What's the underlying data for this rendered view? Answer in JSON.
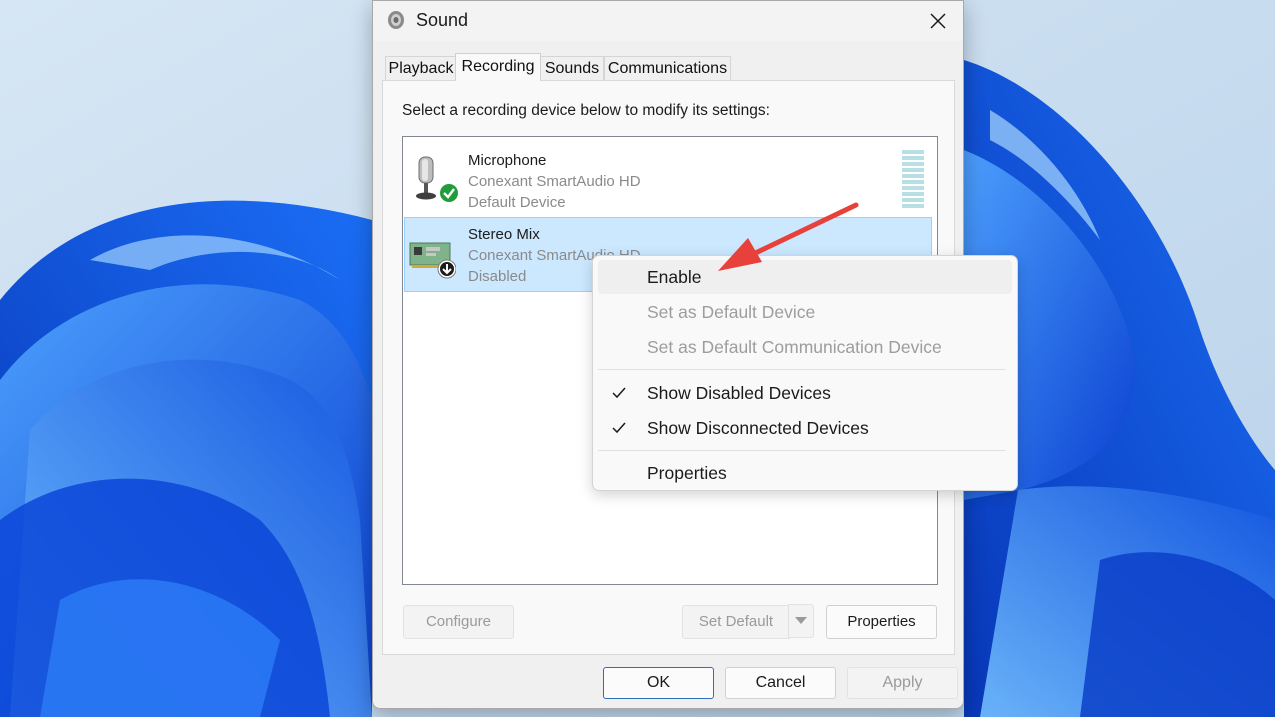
{
  "window": {
    "title": "Sound"
  },
  "tabs": [
    {
      "label": "Playback"
    },
    {
      "label": "Recording"
    },
    {
      "label": "Sounds"
    },
    {
      "label": "Communications"
    }
  ],
  "active_tab": "Recording",
  "instruction": "Select a recording device below to modify its settings:",
  "devices": [
    {
      "name": "Microphone",
      "driver": "Conexant SmartAudio HD",
      "status": "Default Device",
      "icon": "microphone-icon",
      "badge": "default-check-icon"
    },
    {
      "name": "Stereo Mix",
      "driver": "Conexant SmartAudio HD",
      "status": "Disabled",
      "icon": "sound-card-icon",
      "badge": "disabled-arrow-icon"
    }
  ],
  "panel_buttons": {
    "configure": "Configure",
    "set_default": "Set Default",
    "properties": "Properties"
  },
  "dialog_buttons": {
    "ok": "OK",
    "cancel": "Cancel",
    "apply": "Apply"
  },
  "context_menu": {
    "items": [
      {
        "label": "Enable",
        "enabled": true,
        "checked": false,
        "highlighted": true
      },
      {
        "label": "Set as Default Device",
        "enabled": false,
        "checked": false
      },
      {
        "label": "Set as Default Communication Device",
        "enabled": false,
        "checked": false
      },
      {
        "label": "Show Disabled Devices",
        "enabled": true,
        "checked": true
      },
      {
        "label": "Show Disconnected Devices",
        "enabled": true,
        "checked": true
      },
      {
        "label": "Properties",
        "enabled": true,
        "checked": false
      }
    ]
  },
  "colors": {
    "selection": "#cce8ff",
    "selection_border": "#99d1ff",
    "annotation_arrow": "#e8403a",
    "default_badge": "#1f9d3a"
  }
}
